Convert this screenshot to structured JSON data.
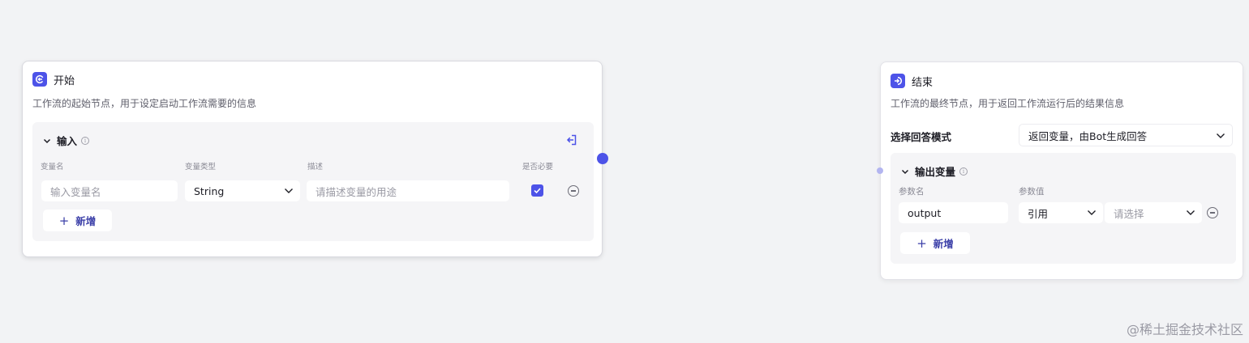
{
  "start_node": {
    "title": "开始",
    "description": "工作流的起始节点，用于设定启动工作流需要的信息",
    "input_section": {
      "title": "输入",
      "columns": {
        "name": "变量名",
        "type": "变量类型",
        "description": "描述",
        "required": "是否必要"
      },
      "rows": [
        {
          "name_placeholder": "输入变量名",
          "type_value": "String",
          "description_placeholder": "请描述变量的用途",
          "required": true
        }
      ],
      "add_label": "新增"
    }
  },
  "end_node": {
    "title": "结束",
    "description": "工作流的最终节点，用于返回工作流运行后的结果信息",
    "mode_label": "选择回答模式",
    "mode_value": "返回变量，由Bot生成回答",
    "output_section": {
      "title": "输出变量",
      "columns": {
        "name": "参数名",
        "value": "参数值"
      },
      "rows": [
        {
          "name_value": "output",
          "ref_type": "引用",
          "ref_placeholder": "请选择"
        }
      ],
      "add_label": "新增"
    }
  },
  "colors": {
    "accent": "#4d53e8",
    "canvas": "#f2f3f5"
  },
  "watermark": "@稀土掘金技术社区"
}
